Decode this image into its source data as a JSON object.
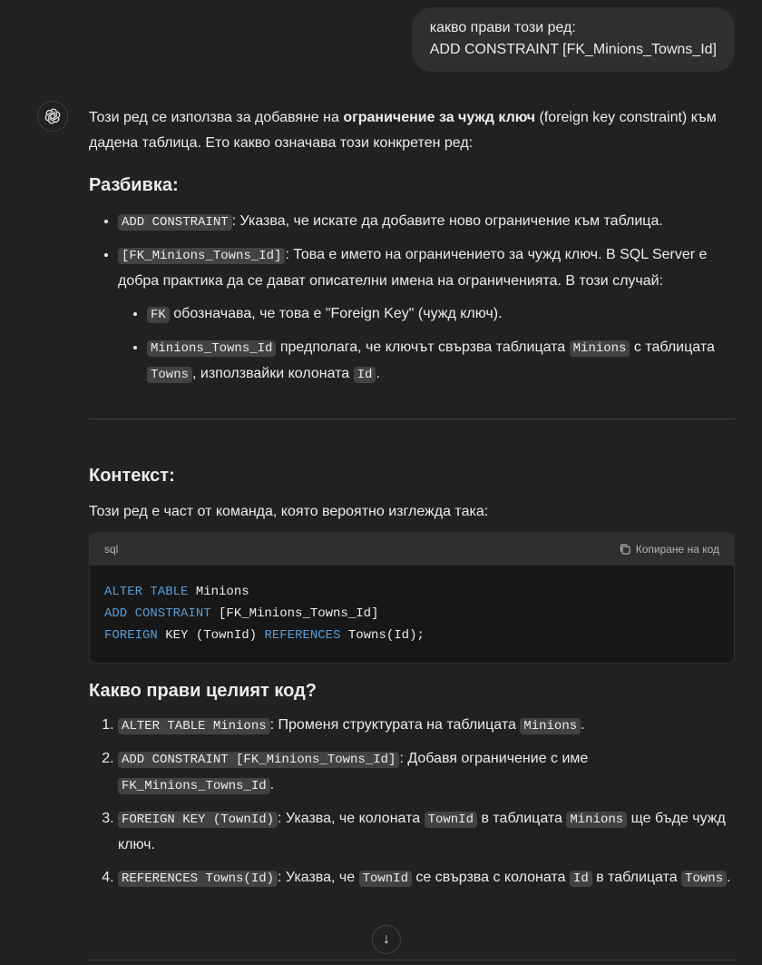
{
  "user_message": {
    "line1": "какво прави този ред:",
    "line2": "ADD CONSTRAINT [FK_Minions_Towns_Id]"
  },
  "assistant": {
    "intro": [
      {
        "t": "Този ред се използва за добавяне на "
      },
      {
        "b": "ограничение за чужд ключ"
      },
      {
        "t": " (foreign key constraint) към дадена таблица. Ето какво означава този конкретен ред:"
      }
    ],
    "breakdown_heading": "Разбивка:",
    "breakdown": [
      [
        {
          "c": "ADD CONSTRAINT"
        },
        {
          "t": ": Указва, че искате да добавите ново ограничение към таблица."
        }
      ],
      [
        {
          "c": "[FK_Minions_Towns_Id]"
        },
        {
          "t": ": Това е името на ограничението за чужд ключ. В SQL Server е добра практика да се дават описателни имена на ограниченията. В този случай:"
        }
      ]
    ],
    "sub_breakdown": [
      [
        {
          "c": "FK"
        },
        {
          "t": " обозначава, че това е \"Foreign Key\" (чужд ключ)."
        }
      ],
      [
        {
          "c": "Minions_Towns_Id"
        },
        {
          "t": " предполага, че ключът свързва таблицата "
        },
        {
          "c": "Minions"
        },
        {
          "t": " с таблицата "
        },
        {
          "c": "Towns"
        },
        {
          "t": ", използвайки колоната "
        },
        {
          "c": "Id"
        },
        {
          "t": "."
        }
      ]
    ],
    "context_heading": "Контекст:",
    "context_text": "Този ред е част от команда, която вероятно изглежда така:",
    "code_block": {
      "language": "sql",
      "copy_label": "Копиране на код",
      "lines": [
        [
          {
            "k": "ALTER TABLE"
          },
          {
            "p": " Minions"
          }
        ],
        [
          {
            "k": "ADD CONSTRAINT"
          },
          {
            "p": " [FK_Minions_Towns_Id]"
          }
        ],
        [
          {
            "k": "FOREIGN"
          },
          {
            "p": " KEY (TownId) "
          },
          {
            "k": "REFERENCES"
          },
          {
            "p": " Towns(Id);"
          }
        ]
      ]
    },
    "whole_heading": "Какво прави целият код?",
    "steps": [
      [
        {
          "c": "ALTER TABLE Minions"
        },
        {
          "t": ": Променя структурата на таблицата "
        },
        {
          "c": "Minions"
        },
        {
          "t": "."
        }
      ],
      [
        {
          "c": "ADD CONSTRAINT [FK_Minions_Towns_Id]"
        },
        {
          "t": ": Добавя ограничение с име "
        },
        {
          "c": "FK_Minions_Towns_Id"
        },
        {
          "t": "."
        }
      ],
      [
        {
          "c": "FOREIGN KEY (TownId)"
        },
        {
          "t": ": Указва, че колоната "
        },
        {
          "c": "TownId"
        },
        {
          "t": " в таблицата "
        },
        {
          "c": "Minions"
        },
        {
          "t": " ще бъде чужд ключ."
        }
      ],
      [
        {
          "c": "REFERENCES Towns(Id)"
        },
        {
          "t": ": Указва, че "
        },
        {
          "c": "TownId"
        },
        {
          "t": " се свързва с колоната "
        },
        {
          "c": "Id"
        },
        {
          "t": " в таблицата "
        },
        {
          "c": "Towns"
        },
        {
          "t": "."
        }
      ]
    ]
  },
  "colors": {
    "background": "#212121",
    "keyword": "#569cd6"
  }
}
